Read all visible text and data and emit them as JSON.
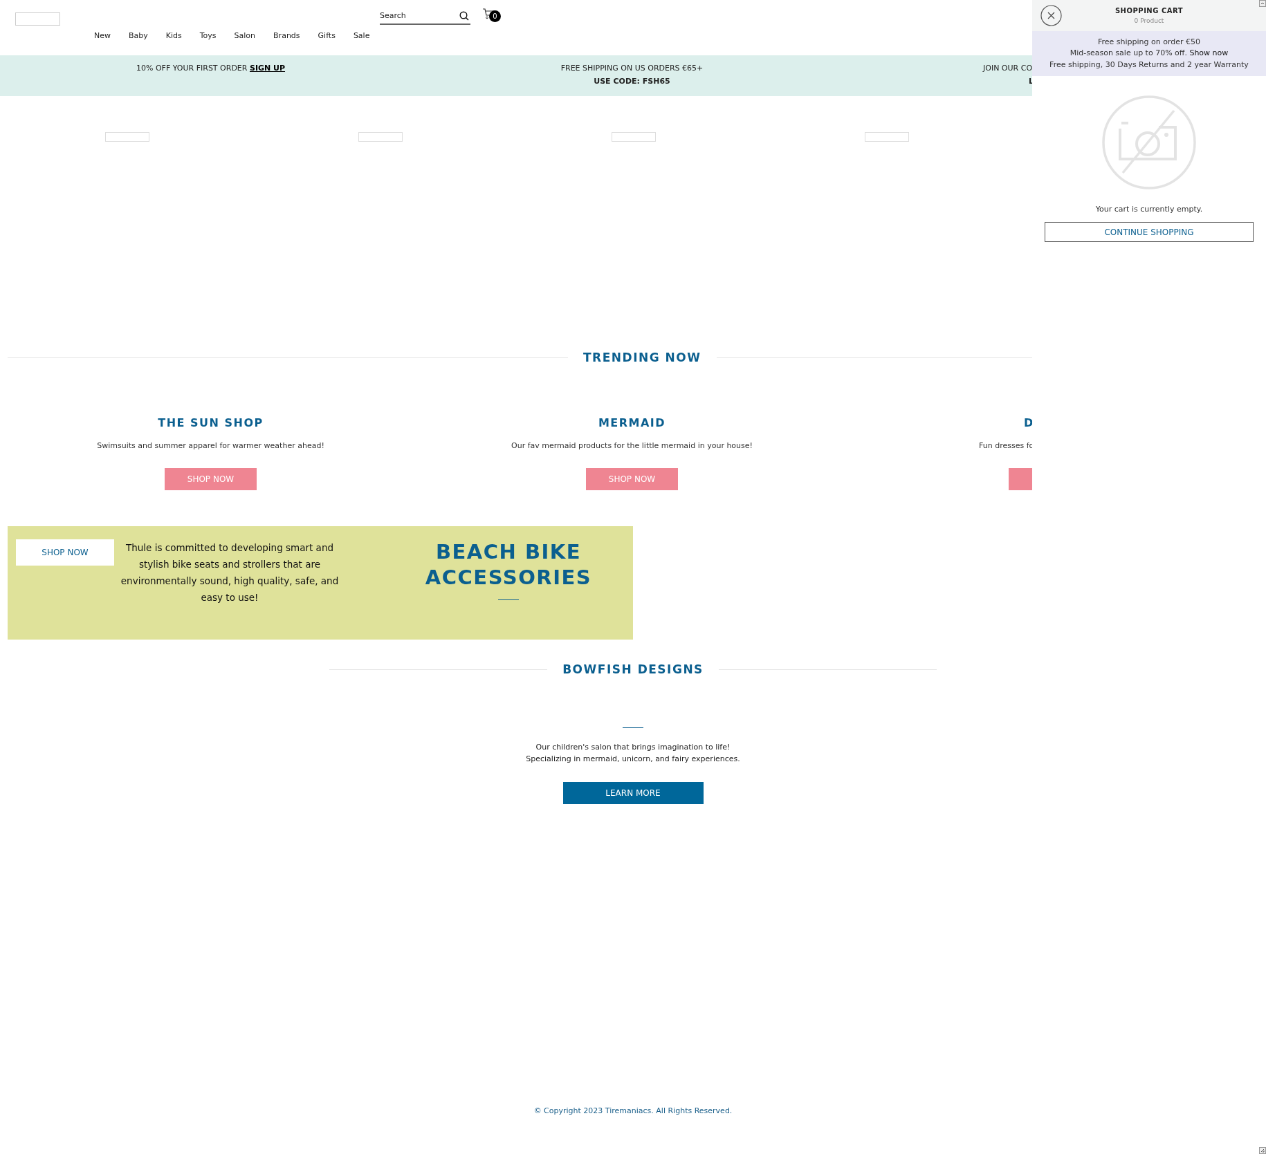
{
  "header": {
    "search": {
      "placeholder": "Search"
    },
    "cart_count": "0",
    "nav": [
      {
        "label": "New"
      },
      {
        "label": "Baby"
      },
      {
        "label": "Kids"
      },
      {
        "label": "Toys"
      },
      {
        "label": "Salon"
      },
      {
        "label": "Brands"
      },
      {
        "label": "Gifts"
      },
      {
        "label": "Sale"
      }
    ]
  },
  "promo_bar": [
    {
      "kind": "link",
      "text": "10% OFF YOUR FIRST ORDER",
      "link": "SIGN UP"
    },
    {
      "kind": "code",
      "text": "FREE SHIPPING ON US ORDERS €65+",
      "code": "USE CODE: FSH65"
    },
    {
      "kind": "cut",
      "text": "JOIN OUR CO",
      "code": "L"
    }
  ],
  "image_placeholders": [
    {
      "kind": "empty"
    },
    {
      "kind": "empty"
    },
    {
      "kind": "empty"
    },
    {
      "kind": "empty"
    }
  ],
  "trending": {
    "title": "TRENDING NOW",
    "collections": [
      {
        "kind": "full",
        "title": "THE SUN SHOP",
        "description": "Swimsuits and summer apparel for warmer weather ahead!",
        "button": "SHOP NOW"
      },
      {
        "kind": "full",
        "title": "MERMAID",
        "description": "Our fav mermaid products for the little mermaid in your house!",
        "button": "SHOP NOW"
      },
      {
        "kind": "cut",
        "title": "D",
        "description": "Fun dresses fo"
      }
    ]
  },
  "promo_banner": {
    "button": "SHOP NOW",
    "text": "Thule is committed to developing smart and stylish bike seats and strollers that are environmentally sound, high quality, safe, and easy to use!",
    "title": "BEACH BIKE ACCESSORIES"
  },
  "bowfish": {
    "title": "BOWFISH DESIGNS",
    "lines": [
      "Our children's salon that brings imagination to life!",
      "Specializing in mermaid, unicorn, and fairy experiences."
    ],
    "button": "LEARN MORE"
  },
  "footer": {
    "copyright": "© Copyright 2023 Tiremaniacs. All Rights Reserved."
  },
  "cart": {
    "title": "SHOPPING CART",
    "count": "0 Product",
    "notices": [
      {
        "text": "Free shipping on order €50"
      },
      {
        "text": "Mid-season sale up to 70% off.",
        "link": "Show now"
      },
      {
        "text": "Free shipping, 30 Days Returns and 2 year Warranty"
      }
    ],
    "empty_message": "Your cart is currently empty.",
    "button": "CONTINUE SHOPPING"
  }
}
